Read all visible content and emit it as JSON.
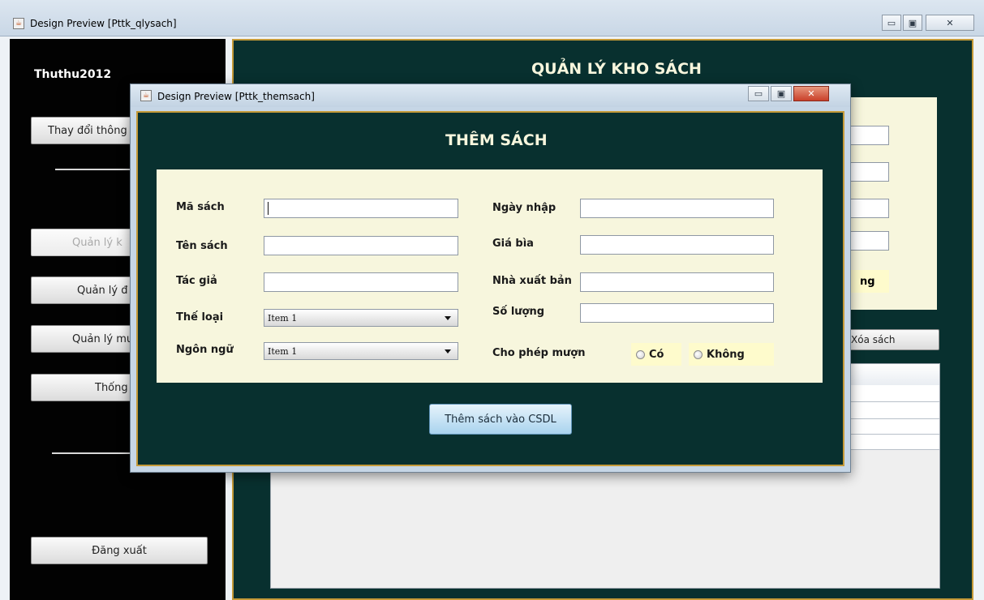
{
  "main_window": {
    "title": "Design Preview [Pttk_qlysach]",
    "controls": [
      "minimize-icon",
      "maximize-icon",
      "close-icon"
    ],
    "user_label": "Thuthu2012",
    "sidebar_buttons": {
      "change_info": "Thay đổi thông",
      "manage_books": "Quản lý k",
      "manage_readers": "Quản lý đ",
      "manage_borrow": "Quản lý mư",
      "statistics": "Thống",
      "logout": "Đăng xuất"
    },
    "panel_title": "QUẢN LÝ KHO SÁCH",
    "partial_label": "ng",
    "delete_button": "Xóa sách"
  },
  "dialog": {
    "title": "Design Preview [Pttk_themsach]",
    "heading": "THÊM SÁCH",
    "labels": {
      "book_id": "Mã sách",
      "book_name": "Tên sách",
      "author": "Tác giả",
      "genre": "Thế loại",
      "language": "Ngôn ngữ",
      "import_date": "Ngày nhập",
      "cover_price": "Giá bìa",
      "publisher": "Nhà xuất bản",
      "quantity": "Số lượng",
      "allow_borrow": "Cho phép mượn"
    },
    "values": {
      "book_id": "",
      "book_name": "",
      "author": "",
      "import_date": "",
      "cover_price": "",
      "publisher": "",
      "quantity": ""
    },
    "genre_selected": "Item 1",
    "language_selected": "Item 1",
    "radio_yes": "Có",
    "radio_no": "Không",
    "submit_button": "Thêm sách vào CSDL"
  },
  "colors": {
    "panel_bg": "#08302f",
    "border_gold": "#c59a38",
    "form_bg": "#f7f6dd",
    "sidebar_bg": "#020202",
    "close_red": "#c9402a"
  }
}
